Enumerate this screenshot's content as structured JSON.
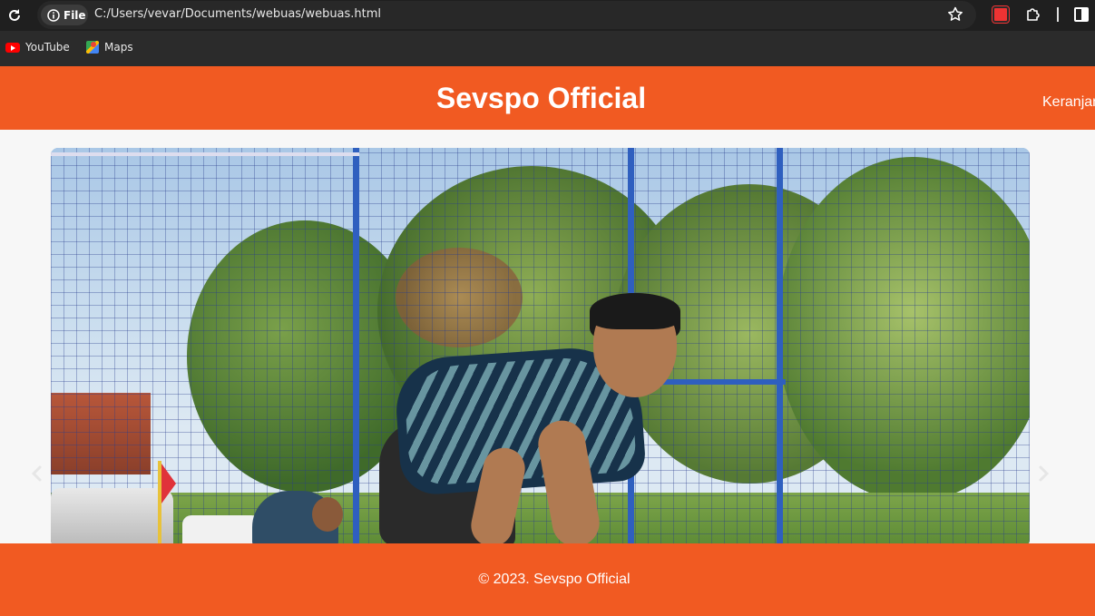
{
  "browser": {
    "chip_label": "File",
    "url": "C:/Users/vevar/Documents/webuas/webuas.html",
    "bookmarks": [
      {
        "label": "YouTube",
        "icon": "youtube-icon"
      },
      {
        "label": "Maps",
        "icon": "maps-icon"
      }
    ]
  },
  "header": {
    "title": "Sevspo Official",
    "cart_label": "Keranjang"
  },
  "carousel": {
    "prev_icon": "chevron-left-icon",
    "next_icon": "chevron-right-icon"
  },
  "footer": {
    "text": "© 2023. Sevspo Official"
  },
  "colors": {
    "brand": "#f15a22",
    "chrome_bg": "#1f1f1f",
    "bookmarks_bg": "#2b2b2b"
  }
}
